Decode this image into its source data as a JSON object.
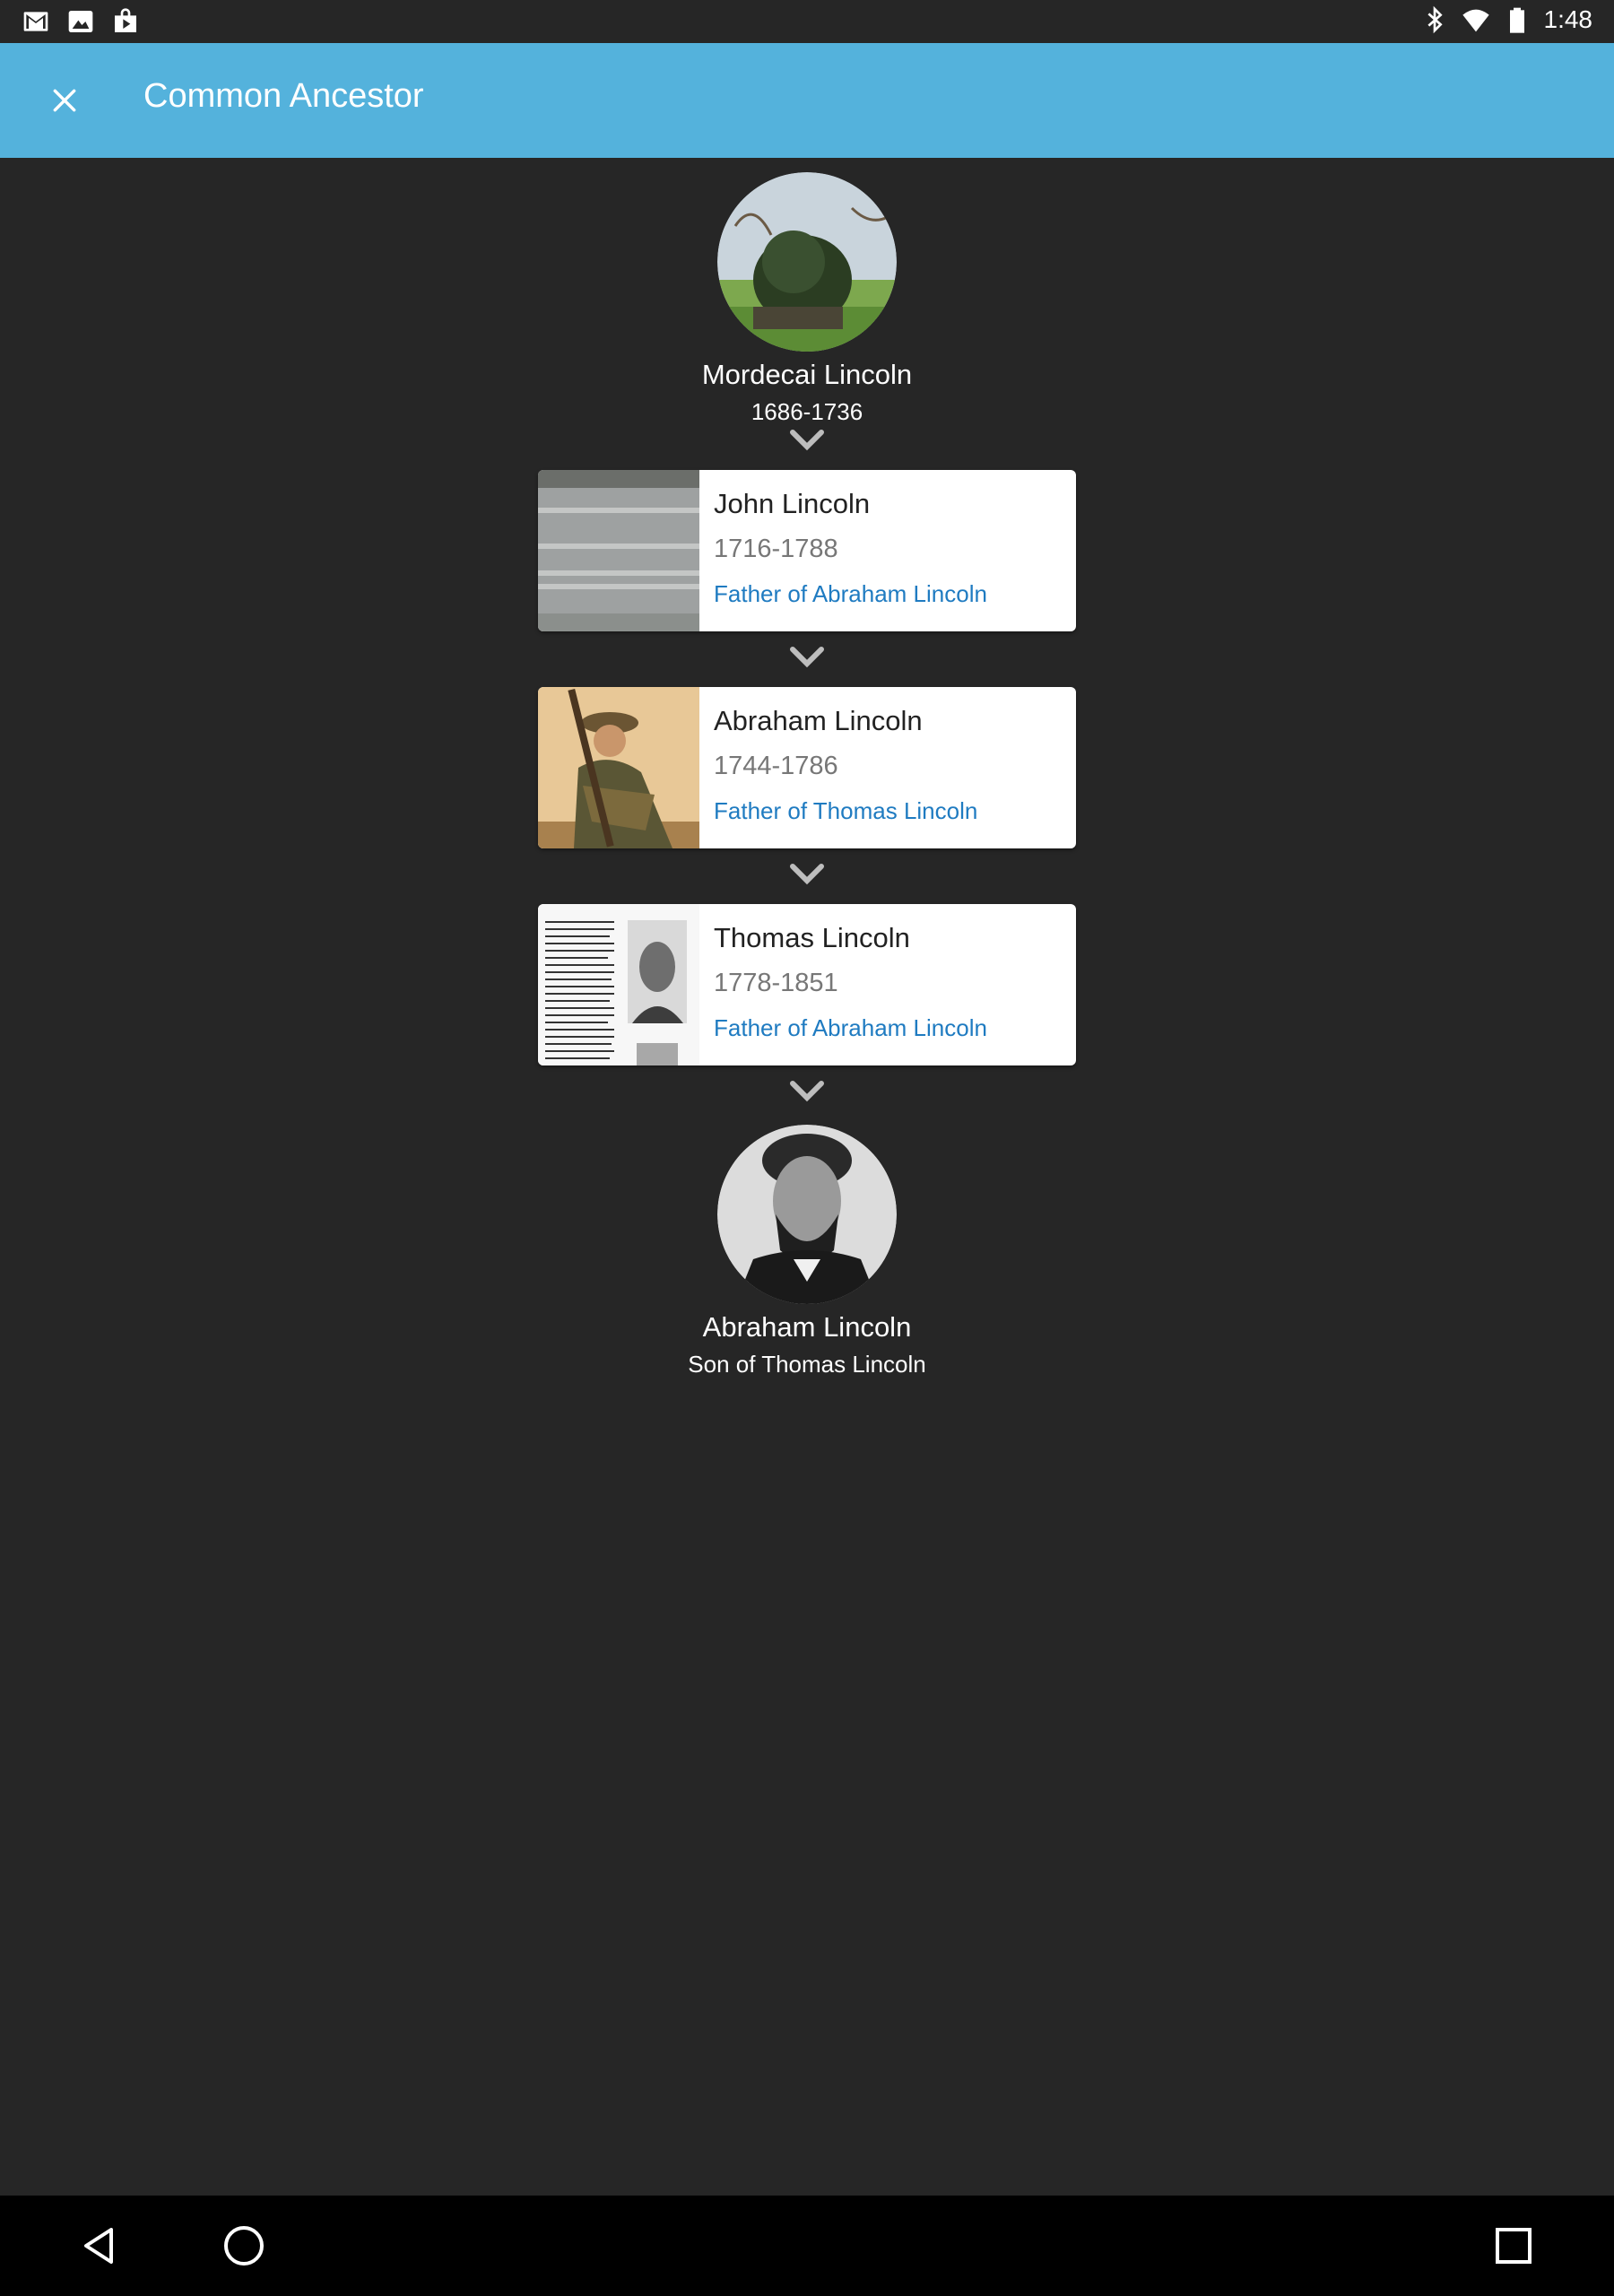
{
  "status_bar": {
    "time": "1:48",
    "left_icons": [
      "gmail-icon",
      "photos-icon",
      "play-store-icon"
    ],
    "right_icons": [
      "bluetooth-icon",
      "wifi-icon",
      "battery-icon"
    ]
  },
  "app_bar": {
    "title": "Common Ancestor",
    "close_icon": "close-icon",
    "background": "#54b2dc"
  },
  "root": {
    "name": "Mordecai Lincoln",
    "years": "1686-1736"
  },
  "cards": [
    {
      "name": "John Lincoln",
      "years": "1716-1788",
      "relation": "Father of Abraham Lincoln"
    },
    {
      "name": "Abraham Lincoln",
      "years": "1744-1786",
      "relation": "Father of Thomas Lincoln"
    },
    {
      "name": "Thomas Lincoln",
      "years": "1778-1851",
      "relation": "Father of Abraham Lincoln"
    }
  ],
  "end": {
    "name": "Abraham Lincoln",
    "relation": "Son of Thomas Lincoln"
  },
  "colors": {
    "background": "#262626",
    "relation_link": "#1f7bc1"
  },
  "nav_bar": {
    "icons": [
      "back-icon",
      "home-icon",
      "recents-icon"
    ]
  }
}
